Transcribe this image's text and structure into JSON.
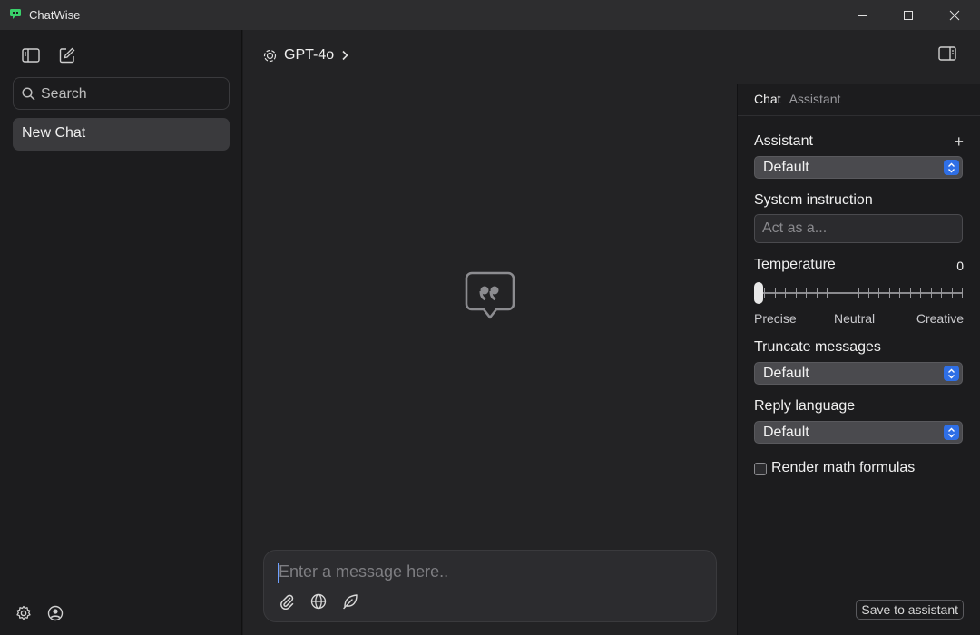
{
  "window": {
    "title": "ChatWise",
    "controls": [
      "minimize",
      "maximize",
      "close"
    ]
  },
  "sidebar": {
    "search_placeholder": "Search",
    "chats": [
      {
        "label": "New Chat",
        "active": true
      }
    ]
  },
  "header": {
    "model_name": "GPT-4o"
  },
  "composer": {
    "placeholder": "Enter a message here.."
  },
  "right_panel": {
    "tabs": [
      {
        "label": "Chat",
        "active": true
      },
      {
        "label": "Assistant",
        "active": false
      }
    ],
    "assistant": {
      "label": "Assistant",
      "value": "Default"
    },
    "system_instruction": {
      "label": "System instruction",
      "placeholder": "Act as a..."
    },
    "temperature": {
      "label": "Temperature",
      "value": "0",
      "scale_labels": [
        "Precise",
        "Neutral",
        "Creative"
      ]
    },
    "truncate": {
      "label": "Truncate messages",
      "value": "Default"
    },
    "reply_language": {
      "label": "Reply language",
      "value": "Default"
    },
    "render_math": {
      "label": "Render math formulas",
      "checked": false
    },
    "save_button": "Save to assistant"
  },
  "colors": {
    "accent": "#2f6fe6",
    "app_icon": "#3ad16b"
  }
}
